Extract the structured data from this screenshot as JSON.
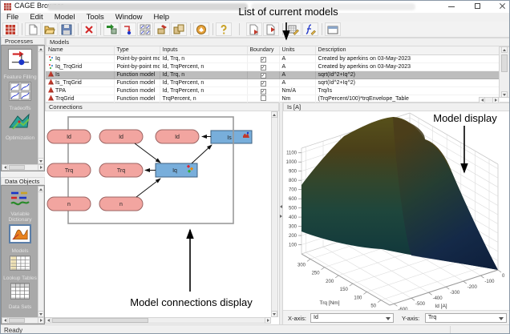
{
  "titlebar": {
    "title": "CAGE Browser -"
  },
  "menu": {
    "items": [
      "File",
      "Edit",
      "Model",
      "Tools",
      "Window",
      "Help"
    ]
  },
  "toolbar": {
    "icons": [
      "cage-browser-icon",
      "new-file-icon",
      "open-file-icon",
      "save-icon",
      "delete-icon",
      "import-model-icon",
      "new-feature-icon",
      "new-tradeoff-icon",
      "new-package-icon",
      "copy-package-icon",
      "optimization-icon",
      "help-icon",
      "export-cal-icon",
      "import-cal-icon",
      "edit-table-icon",
      "edit-function-icon",
      "view-window-icon"
    ]
  },
  "sidebar": {
    "processes": {
      "header": "Processes",
      "items": [
        {
          "label": "Feature Filling"
        },
        {
          "label": "Tradeoffs"
        },
        {
          "label": "Optimization"
        }
      ]
    },
    "data_objects": {
      "header": "Data Objects",
      "items": [
        {
          "label": "Variable Dictionary"
        },
        {
          "label": "Models",
          "selected": true
        },
        {
          "label": "Lookup Tables"
        },
        {
          "label": "Data Sets"
        }
      ]
    }
  },
  "models_table": {
    "header": "Models",
    "columns": [
      "Name",
      "Type",
      "Inputs",
      "Boundary",
      "Units",
      "Description"
    ],
    "rows": [
      {
        "name": "Iq",
        "type": "Point-by-point model",
        "inputs": "Id, Trq, n",
        "boundary": "✓",
        "units": "A",
        "description": "Created by aperkins on 03-May-2023",
        "selected": false
      },
      {
        "name": "Iq_TrqGrid",
        "type": "Point-by-point model",
        "inputs": "Id, TrqPercent, n",
        "boundary": "✓",
        "units": "A",
        "description": "Created by aperkins on 03-May-2023",
        "selected": false
      },
      {
        "name": "Is",
        "type": "Function model",
        "inputs": "Id, Trq, n",
        "boundary": "✓",
        "units": "A",
        "description": "sqrt(Id^2+Iq^2)",
        "selected": true
      },
      {
        "name": "Is_TrqGrid",
        "type": "Function model",
        "inputs": "Id, TrqPercent, n",
        "boundary": "✓",
        "units": "A",
        "description": "sqrt(Id^2+Iq^2)",
        "selected": false
      },
      {
        "name": "TPA",
        "type": "Function model",
        "inputs": "Id, TrqPercent, n",
        "boundary": "✓",
        "units": "Nm/A",
        "description": "Trq/Is",
        "selected": false
      },
      {
        "name": "TrqGrid",
        "type": "Function model",
        "inputs": "TrqPercent, n",
        "boundary": "",
        "units": "Nm",
        "description": "(TrqPercent/100)*trqEnvelope_Table",
        "selected": false
      }
    ]
  },
  "connections": {
    "header": "Connections",
    "col1": [
      "Id",
      "Trq",
      "n"
    ],
    "col2": [
      "Id",
      "Trq",
      "n"
    ],
    "col3": [
      "Id"
    ],
    "models": [
      "Iq",
      "Is"
    ]
  },
  "model_display": {
    "header": "Is [A]",
    "x_axis_label": "X-axis:",
    "x_axis_value": "Id",
    "y_axis_label": "Y-axis:",
    "y_axis_value": "Trq"
  },
  "chart_data": {
    "type": "surface",
    "title": "Is [A]",
    "xlabel": "Id [A]",
    "ylabel": "Trq [Nm]",
    "zlabel": "Is [A]",
    "x_ticks": [
      -600,
      -500,
      -400,
      -300,
      -200,
      -100,
      0
    ],
    "y_ticks": [
      300,
      250,
      200,
      150,
      100,
      50
    ],
    "z_ticks": [
      100,
      200,
      300,
      400,
      500,
      600,
      700,
      800,
      900,
      1000,
      1100
    ],
    "zlim": [
      0,
      1150
    ],
    "grid": true,
    "z_estimate_grid": {
      "trq": [
        300,
        175,
        50
      ],
      "id": [
        -600,
        -300,
        0
      ],
      "z": [
        [
          700,
          1100,
          350
        ],
        [
          600,
          800,
          150
        ],
        [
          450,
          500,
          50
        ]
      ]
    },
    "colors": {
      "peak": "#57501a",
      "mid": "#1e463c",
      "low": "#0d1b3b"
    }
  },
  "annotations": {
    "top": "List of current models",
    "right": "Model display",
    "bottom": "Model connections display"
  },
  "status": {
    "text": "Ready"
  }
}
